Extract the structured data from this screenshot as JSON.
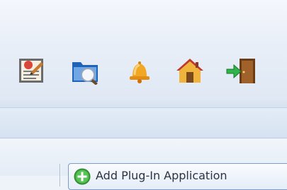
{
  "toolbar": {
    "icons": [
      "document-edit-icon",
      "folder-search-icon",
      "bell-icon",
      "home-icon",
      "exit-door-icon"
    ]
  },
  "actions": {
    "add_plugin_label": "Add Plug-In Application",
    "add_plugin_icon": "green-plus-icon"
  },
  "colors": {
    "toolbar_bg": "#eef3fa",
    "button_border": "#7e9cc7",
    "plus_green": "#3aa53a"
  }
}
